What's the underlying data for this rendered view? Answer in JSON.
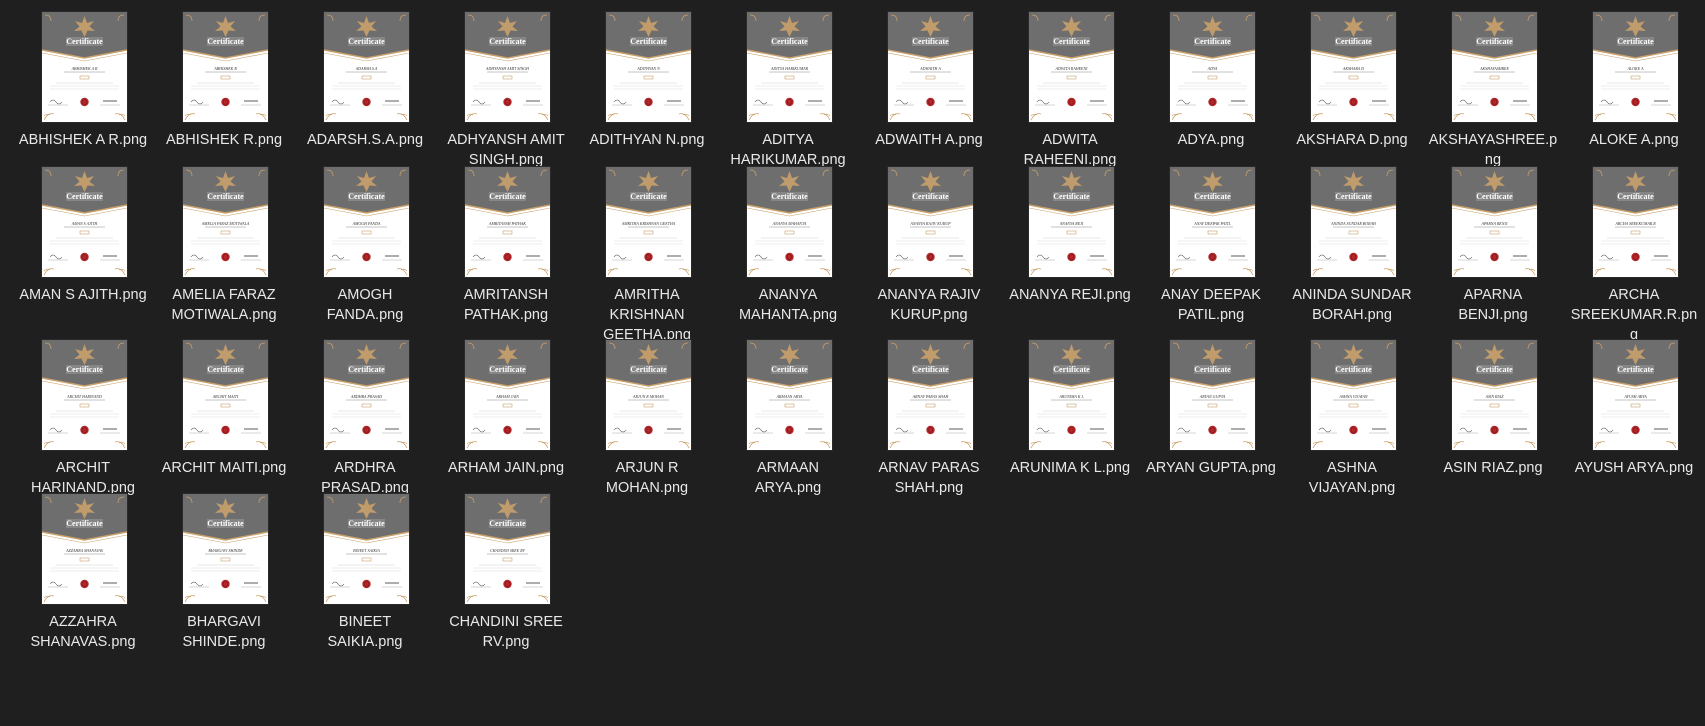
{
  "thumbnail": {
    "header_label": "Certificate",
    "header_color": "#6e6e6e",
    "accent_color": "#c9a06a",
    "seal_color": "#b3262a"
  },
  "files": [
    {
      "name": "ABHISHEK A R.png",
      "recipient": "ABHISHEK A R"
    },
    {
      "name": "ABHISHEK R.png",
      "recipient": "ABHISHEK R"
    },
    {
      "name": "ADARSH.S.A.png",
      "recipient": "ADARSH.S.A"
    },
    {
      "name": "ADHYANSH AMIT SINGH.png",
      "recipient": "ADHYANSH AMIT SINGH"
    },
    {
      "name": "ADITHYAN N.png",
      "recipient": "ADITHYAN N"
    },
    {
      "name": "ADITYA HARIKUMAR.png",
      "recipient": "ADITYA HARIKUMAR"
    },
    {
      "name": "ADWAITH A.png",
      "recipient": "ADWAITH A"
    },
    {
      "name": "ADWITA RAHEENI.png",
      "recipient": "ADWITA RAHEENI"
    },
    {
      "name": "ADYA.png",
      "recipient": "ADYA"
    },
    {
      "name": "AKSHARA D.png",
      "recipient": "AKSHARA D"
    },
    {
      "name": "AKSHAYASHREE.png",
      "recipient": "AKSHAYASHREE"
    },
    {
      "name": "ALOKE A.png",
      "recipient": "ALOKE A"
    },
    {
      "name": "AMAN S AJITH.png",
      "recipient": "AMAN S AJITH"
    },
    {
      "name": "AMELIA FARAZ MOTIWALA.png",
      "recipient": "AMELIA FARAZ MOTIWALA"
    },
    {
      "name": "AMOGH FANDA.png",
      "recipient": "AMOGH FANDA"
    },
    {
      "name": "AMRITANSH PATHAK.png",
      "recipient": "AMRITANSH PATHAK"
    },
    {
      "name": "AMRITHA KRISHNAN GEETHA.png",
      "recipient": "AMRITHA KRISHNAN GEETHA"
    },
    {
      "name": "ANANYA MAHANTA.png",
      "recipient": "ANANYA MAHANTA"
    },
    {
      "name": "ANANYA RAJIV KURUP.png",
      "recipient": "ANANYA RAJIV KURUP"
    },
    {
      "name": "ANANYA REJI.png",
      "recipient": "ANANYA REJI"
    },
    {
      "name": "ANAY DEEPAK PATIL.png",
      "recipient": "ANAY DEEPAK PATIL"
    },
    {
      "name": "ANINDA SUNDAR BORAH.png",
      "recipient": "ANINDA SUNDAR BORAH"
    },
    {
      "name": "APARNA BENJI.png",
      "recipient": "APARNA BENJI"
    },
    {
      "name": "ARCHA SREEKUMAR.R.png",
      "recipient": "ARCHA SREEKUMAR.R"
    },
    {
      "name": "ARCHIT HARINAND.png",
      "recipient": "ARCHIT HARINAND"
    },
    {
      "name": "ARCHIT MAITI.png",
      "recipient": "ARCHIT MAITI"
    },
    {
      "name": "ARDHRA PRASAD.png",
      "recipient": "ARDHRA PRASAD"
    },
    {
      "name": "ARHAM JAIN.png",
      "recipient": "ARHAM JAIN"
    },
    {
      "name": "ARJUN R MOHAN.png",
      "recipient": "ARJUN R MOHAN"
    },
    {
      "name": "ARMAAN ARYA.png",
      "recipient": "ARMAAN ARYA"
    },
    {
      "name": "ARNAV PARAS SHAH.png",
      "recipient": "ARNAV PARAS SHAH"
    },
    {
      "name": "ARUNIMA K L.png",
      "recipient": "ARUNIMA K L"
    },
    {
      "name": "ARYAN GUPTA.png",
      "recipient": "ARYAN GUPTA"
    },
    {
      "name": "ASHNA VIJAYAN.png",
      "recipient": "ASHNA VIJAYAN"
    },
    {
      "name": "ASIN RIAZ.png",
      "recipient": "ASIN RIAZ"
    },
    {
      "name": "AYUSH ARYA.png",
      "recipient": "AYUSH ARYA"
    },
    {
      "name": "AZZAHRA SHANAVAS.png",
      "recipient": "AZZAHRA SHANAVAS"
    },
    {
      "name": "BHARGAVI SHINDE.png",
      "recipient": "BHARGAVI SHINDE"
    },
    {
      "name": "BINEET SAIKIA.png",
      "recipient": "BINEET SAIKIA"
    },
    {
      "name": "CHANDINI SREE RV.png",
      "recipient": "CHANDINI SREE RV"
    }
  ]
}
